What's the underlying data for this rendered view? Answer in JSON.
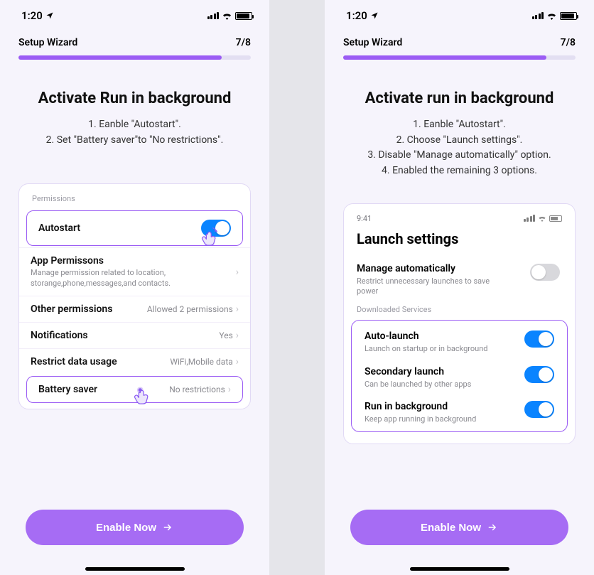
{
  "status": {
    "time": "1:20",
    "wifi": "􀙇",
    "battery_full": true
  },
  "wizard": {
    "title": "Setup Wizard",
    "step": "7/8",
    "progress_pct": 87.5
  },
  "left": {
    "title": "Activate Run in background",
    "instructions": [
      "1. Eanble \"Autostart\".",
      "2. Set \"Battery saver\"to \"No restrictions\"."
    ],
    "card_label": "Permissions",
    "rows": {
      "autostart": {
        "label": "Autostart",
        "on": true
      },
      "app_perm": {
        "label": "App Permissons",
        "sub": "Manage permission related to location, storange,phone,messages,and contacts."
      },
      "other_perm": {
        "label": "Other permissions",
        "value": "Allowed 2 permissions"
      },
      "notifications": {
        "label": "Notifications",
        "value": "Yes"
      },
      "restrict_data": {
        "label": "Restrict data usage",
        "value": "WiFi,Mobile data"
      },
      "battery": {
        "label": "Battery saver",
        "value": "No restrictions"
      }
    }
  },
  "right": {
    "title": "Activate run in background",
    "instructions": [
      "1. Eanble \"Autostart\".",
      "2. Choose \"Launch settings\".",
      "3. Disable \"Manage automatically\" option.",
      "4. Enabled the remaining 3 options."
    ],
    "inner_time": "9:41",
    "inner_title": "Launch settings",
    "manage": {
      "label": "Manage automatically",
      "sub": "Restrict unnecessary launches to save power",
      "on": false
    },
    "section": "Downloaded Services",
    "opts": {
      "auto_launch": {
        "label": "Auto-launch",
        "sub": "Launch on startup or in background",
        "on": true
      },
      "secondary": {
        "label": "Secondary launch",
        "sub": "Can be launched by other apps",
        "on": true
      },
      "run_bg": {
        "label": "Run in background",
        "sub": "Keep app running in background",
        "on": true
      }
    }
  },
  "cta": "Enable Now"
}
